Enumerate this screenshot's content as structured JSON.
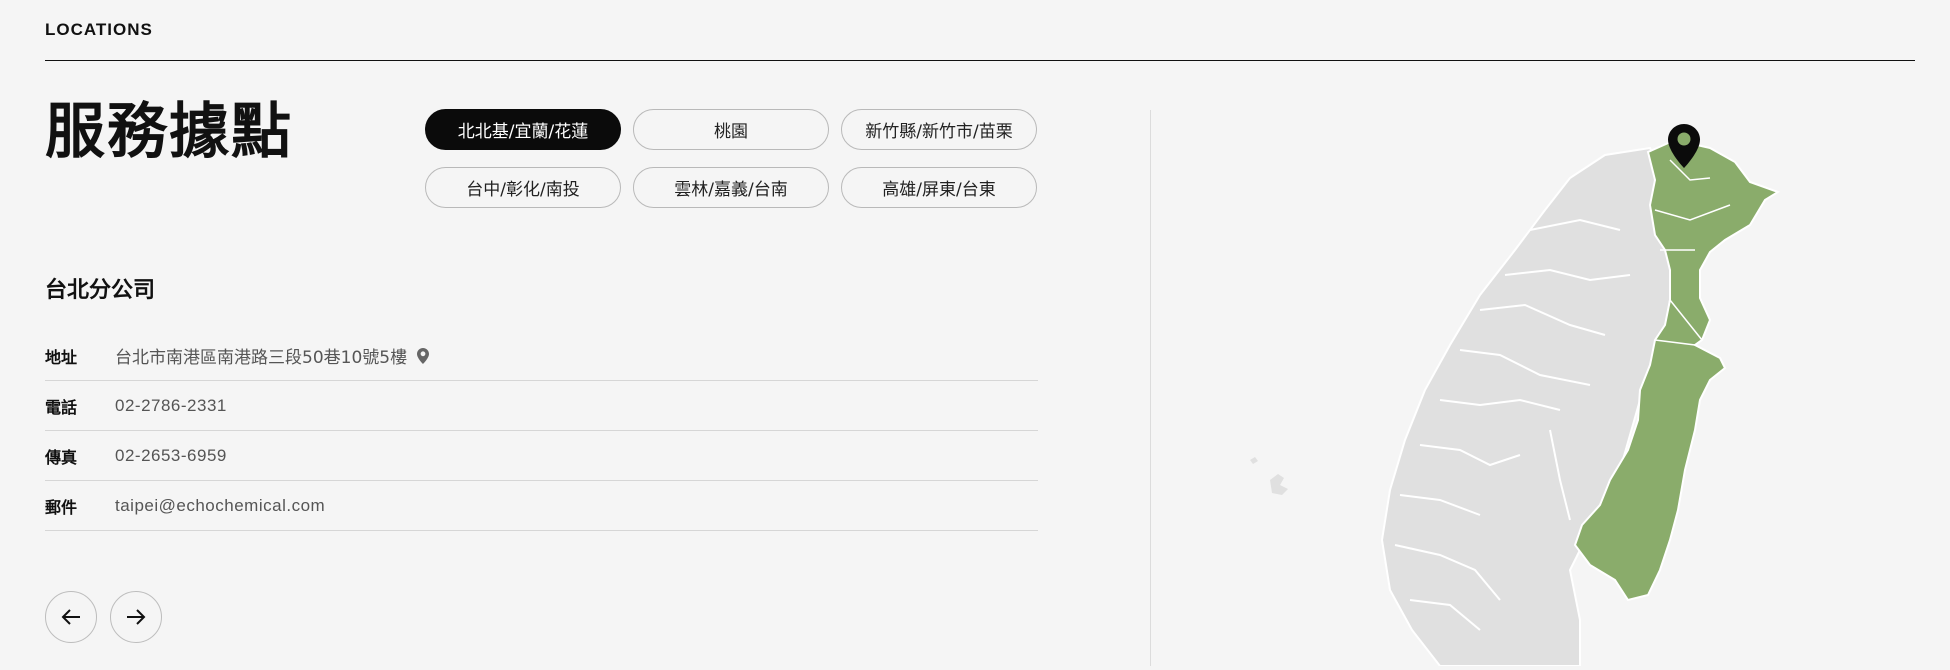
{
  "section": {
    "label": "LOCATIONS"
  },
  "page": {
    "title": "服務據點"
  },
  "regions": [
    {
      "label": "北北基/宜蘭/花蓮",
      "active": true
    },
    {
      "label": "桃園",
      "active": false
    },
    {
      "label": "新竹縣/新竹市/苗栗",
      "active": false
    },
    {
      "label": "台中/彰化/南投",
      "active": false
    },
    {
      "label": "雲林/嘉義/台南",
      "active": false
    },
    {
      "label": "高雄/屏東/台東",
      "active": false
    }
  ],
  "office": {
    "name": "台北分公司",
    "fields": {
      "address_label": "地址",
      "address": "台北市南港區南港路三段50巷10號5樓",
      "phone_label": "電話",
      "phone": "02-2786-2331",
      "fax_label": "傳真",
      "fax": "02-2653-6959",
      "email_label": "郵件",
      "email": "taipei@echochemical.com"
    }
  },
  "nav": {
    "prev_icon": "arrow-left-icon",
    "next_icon": "arrow-right-icon"
  },
  "map": {
    "highlight_color": "#8aac6b",
    "base_color": "#e0e0e0",
    "pin_icon": "location-pin-icon"
  }
}
